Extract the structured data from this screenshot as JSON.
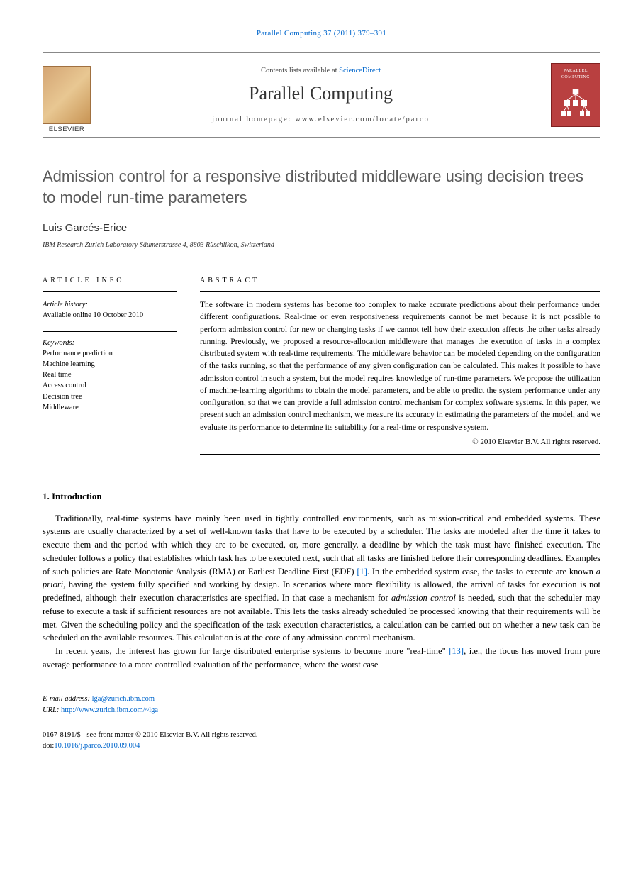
{
  "header": {
    "citation_prefix": "Parallel Computing 37 (2011) 379–391",
    "contents_prefix": "Contents lists available at ",
    "contents_link": "ScienceDirect",
    "journal_name": "Parallel Computing",
    "homepage_prefix": "journal homepage: ",
    "homepage_url": "www.elsevier.com/locate/parco"
  },
  "article": {
    "title": "Admission control for a responsive distributed middleware using decision trees to model run-time parameters",
    "author": "Luis Garcés-Erice",
    "affiliation": "IBM Research Zurich Laboratory Säumerstrasse 4, 8803 Rüschlikon, Switzerland"
  },
  "info": {
    "label": "ARTICLE INFO",
    "history_label": "Article history:",
    "history_value": "Available online 10 October 2010",
    "keywords_label": "Keywords:",
    "keywords": [
      "Performance prediction",
      "Machine learning",
      "Real time",
      "Access control",
      "Decision tree",
      "Middleware"
    ]
  },
  "abstract": {
    "label": "ABSTRACT",
    "text": "The software in modern systems has become too complex to make accurate predictions about their performance under different configurations. Real-time or even responsiveness requirements cannot be met because it is not possible to perform admission control for new or changing tasks if we cannot tell how their execution affects the other tasks already running. Previously, we proposed a resource-allocation middleware that manages the execution of tasks in a complex distributed system with real-time requirements. The middleware behavior can be modeled depending on the configuration of the tasks running, so that the performance of any given configuration can be calculated. This makes it possible to have admission control in such a system, but the model requires knowledge of run-time parameters. We propose the utilization of machine-learning algorithms to obtain the model parameters, and be able to predict the system performance under any configuration, so that we can provide a full admission control mechanism for complex software systems. In this paper, we present such an admission control mechanism, we measure its accuracy in estimating the parameters of the model, and we evaluate its performance to determine its suitability for a real-time or responsive system.",
    "copyright": "© 2010 Elsevier B.V. All rights reserved."
  },
  "introduction": {
    "heading": "1. Introduction",
    "para1_pre": "Traditionally, real-time systems have mainly been used in tightly controlled environments, such as mission-critical and embedded systems. These systems are usually characterized by a set of well-known tasks that have to be executed by a scheduler. The tasks are modeled after the time it takes to execute them and the period with which they are to be executed, or, more generally, a deadline by which the task must have finished execution. The scheduler follows a policy that establishes which task has to be executed next, such that all tasks are finished before their corresponding deadlines. Examples of such policies are Rate Monotonic Analysis (RMA) or Earliest Deadline First (EDF) ",
    "ref1": "[1]",
    "para1_mid": ". In the embedded system case, the tasks to execute are known ",
    "em1": "a priori",
    "para1_post": ", having the system fully specified and working by design. In scenarios where more flexibility is allowed, the arrival of tasks for execution is not predefined, although their execution characteristics are specified. In that case a mechanism for ",
    "em2": "admission control",
    "para1_end": " is needed, such that the scheduler may refuse to execute a task if sufficient resources are not available. This lets the tasks already scheduled be processed knowing that their requirements will be met. Given the scheduling policy and the specification of the task execution characteristics, a calculation can be carried out on whether a new task can be scheduled on the available resources. This calculation is at the core of any admission control mechanism.",
    "para2_pre": "In recent years, the interest has grown for large distributed enterprise systems to become more \"real-time\" ",
    "ref2": "[13]",
    "para2_post": ", i.e., the focus has moved from pure average performance to a more controlled evaluation of the performance, where the worst case"
  },
  "footnote": {
    "email_label": "E-mail address: ",
    "email": "lga@zurich.ibm.com",
    "url_label": "URL: ",
    "url": "http://www.zurich.ibm.com/~lga"
  },
  "footer": {
    "line1": "0167-8191/$ - see front matter © 2010 Elsevier B.V. All rights reserved.",
    "doi_prefix": "doi:",
    "doi": "10.1016/j.parco.2010.09.004"
  }
}
